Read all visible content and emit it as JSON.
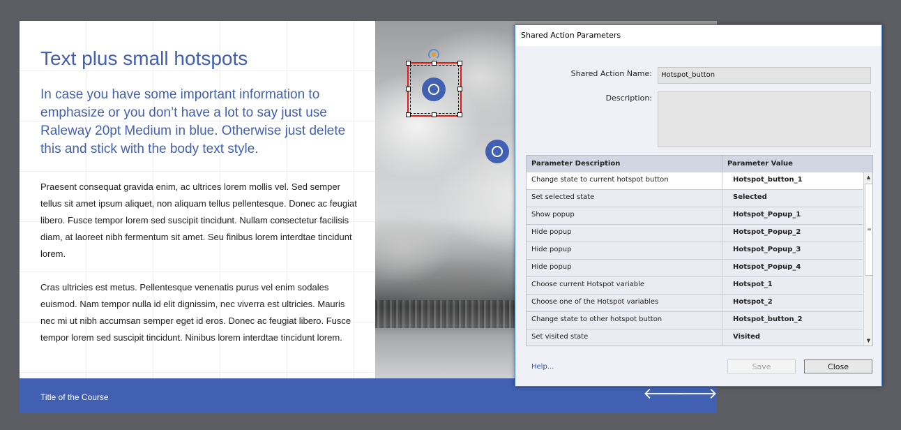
{
  "slide": {
    "title": "Text plus small hotspots",
    "subtitle": "In case you have some important information to emphasize or you don’t have a lot to say just use Raleway 20pt Medium in blue. Otherwise just delete this and stick with the body text style.",
    "body1": "Praesent consequat gravida enim, ac ultrices lorem mollis vel. Sed semper tellus sit amet ipsum aliquet, non aliquam tellus pellentesque. Donec ac feugiat libero. Fusce tempor lorem sed suscipit tincidunt. Nullam consectetur facilisis diam, at laoreet nibh fermentum sit amet. Seu finibus lorem interdtae tincidunt lorem.",
    "body2": "Cras ultricies est metus. Pellentesque venenatis purus vel enim sodales euismod. Nam tempor nulla id elit dignissim, nec viverra est ultricies. Mauris nec mi ut nibh accumsan semper eget id eros. Donec ac feugiat libero. Fusce tempor lorem sed suscipit tincidunt. Ninibus lorem interdtae tincidunt lorem.",
    "footer_title": "Title of the Course",
    "prev_arrow": "🡐",
    "next_arrow": "🡒",
    "accent_color": "#4160b2"
  },
  "dialog": {
    "title": "Shared Action Parameters",
    "name_label": "Shared Action Name:",
    "name_value": "Hotspot_button",
    "desc_label": "Description:",
    "desc_value": "",
    "table_headers": [
      "Parameter Description",
      "Parameter Value"
    ],
    "rows": [
      {
        "desc": "Change state to current hotspot button",
        "value": "Hotspot_button_1"
      },
      {
        "desc": "Set selected state",
        "value": "Selected"
      },
      {
        "desc": "Show popup",
        "value": "Hotspot_Popup_1"
      },
      {
        "desc": "Hide popup",
        "value": "Hotspot_Popup_2"
      },
      {
        "desc": "Hide popup",
        "value": "Hotspot_Popup_3"
      },
      {
        "desc": "Hide popup",
        "value": "Hotspot_Popup_4"
      },
      {
        "desc": "Choose current Hotspot variable",
        "value": "Hotspot_1"
      },
      {
        "desc": "Choose one of the Hotspot variables",
        "value": "Hotspot_2"
      },
      {
        "desc": "Change state to other hotspot button",
        "value": "Hotspot_button_2"
      },
      {
        "desc": "Set visited state",
        "value": "Visited"
      }
    ],
    "help_label": "Help...",
    "save_label": "Save",
    "close_label": "Close",
    "scroll_up": "▲",
    "scroll_down": "▼",
    "scroll_grip": "≡",
    "border_color": "#3e7bc6"
  }
}
